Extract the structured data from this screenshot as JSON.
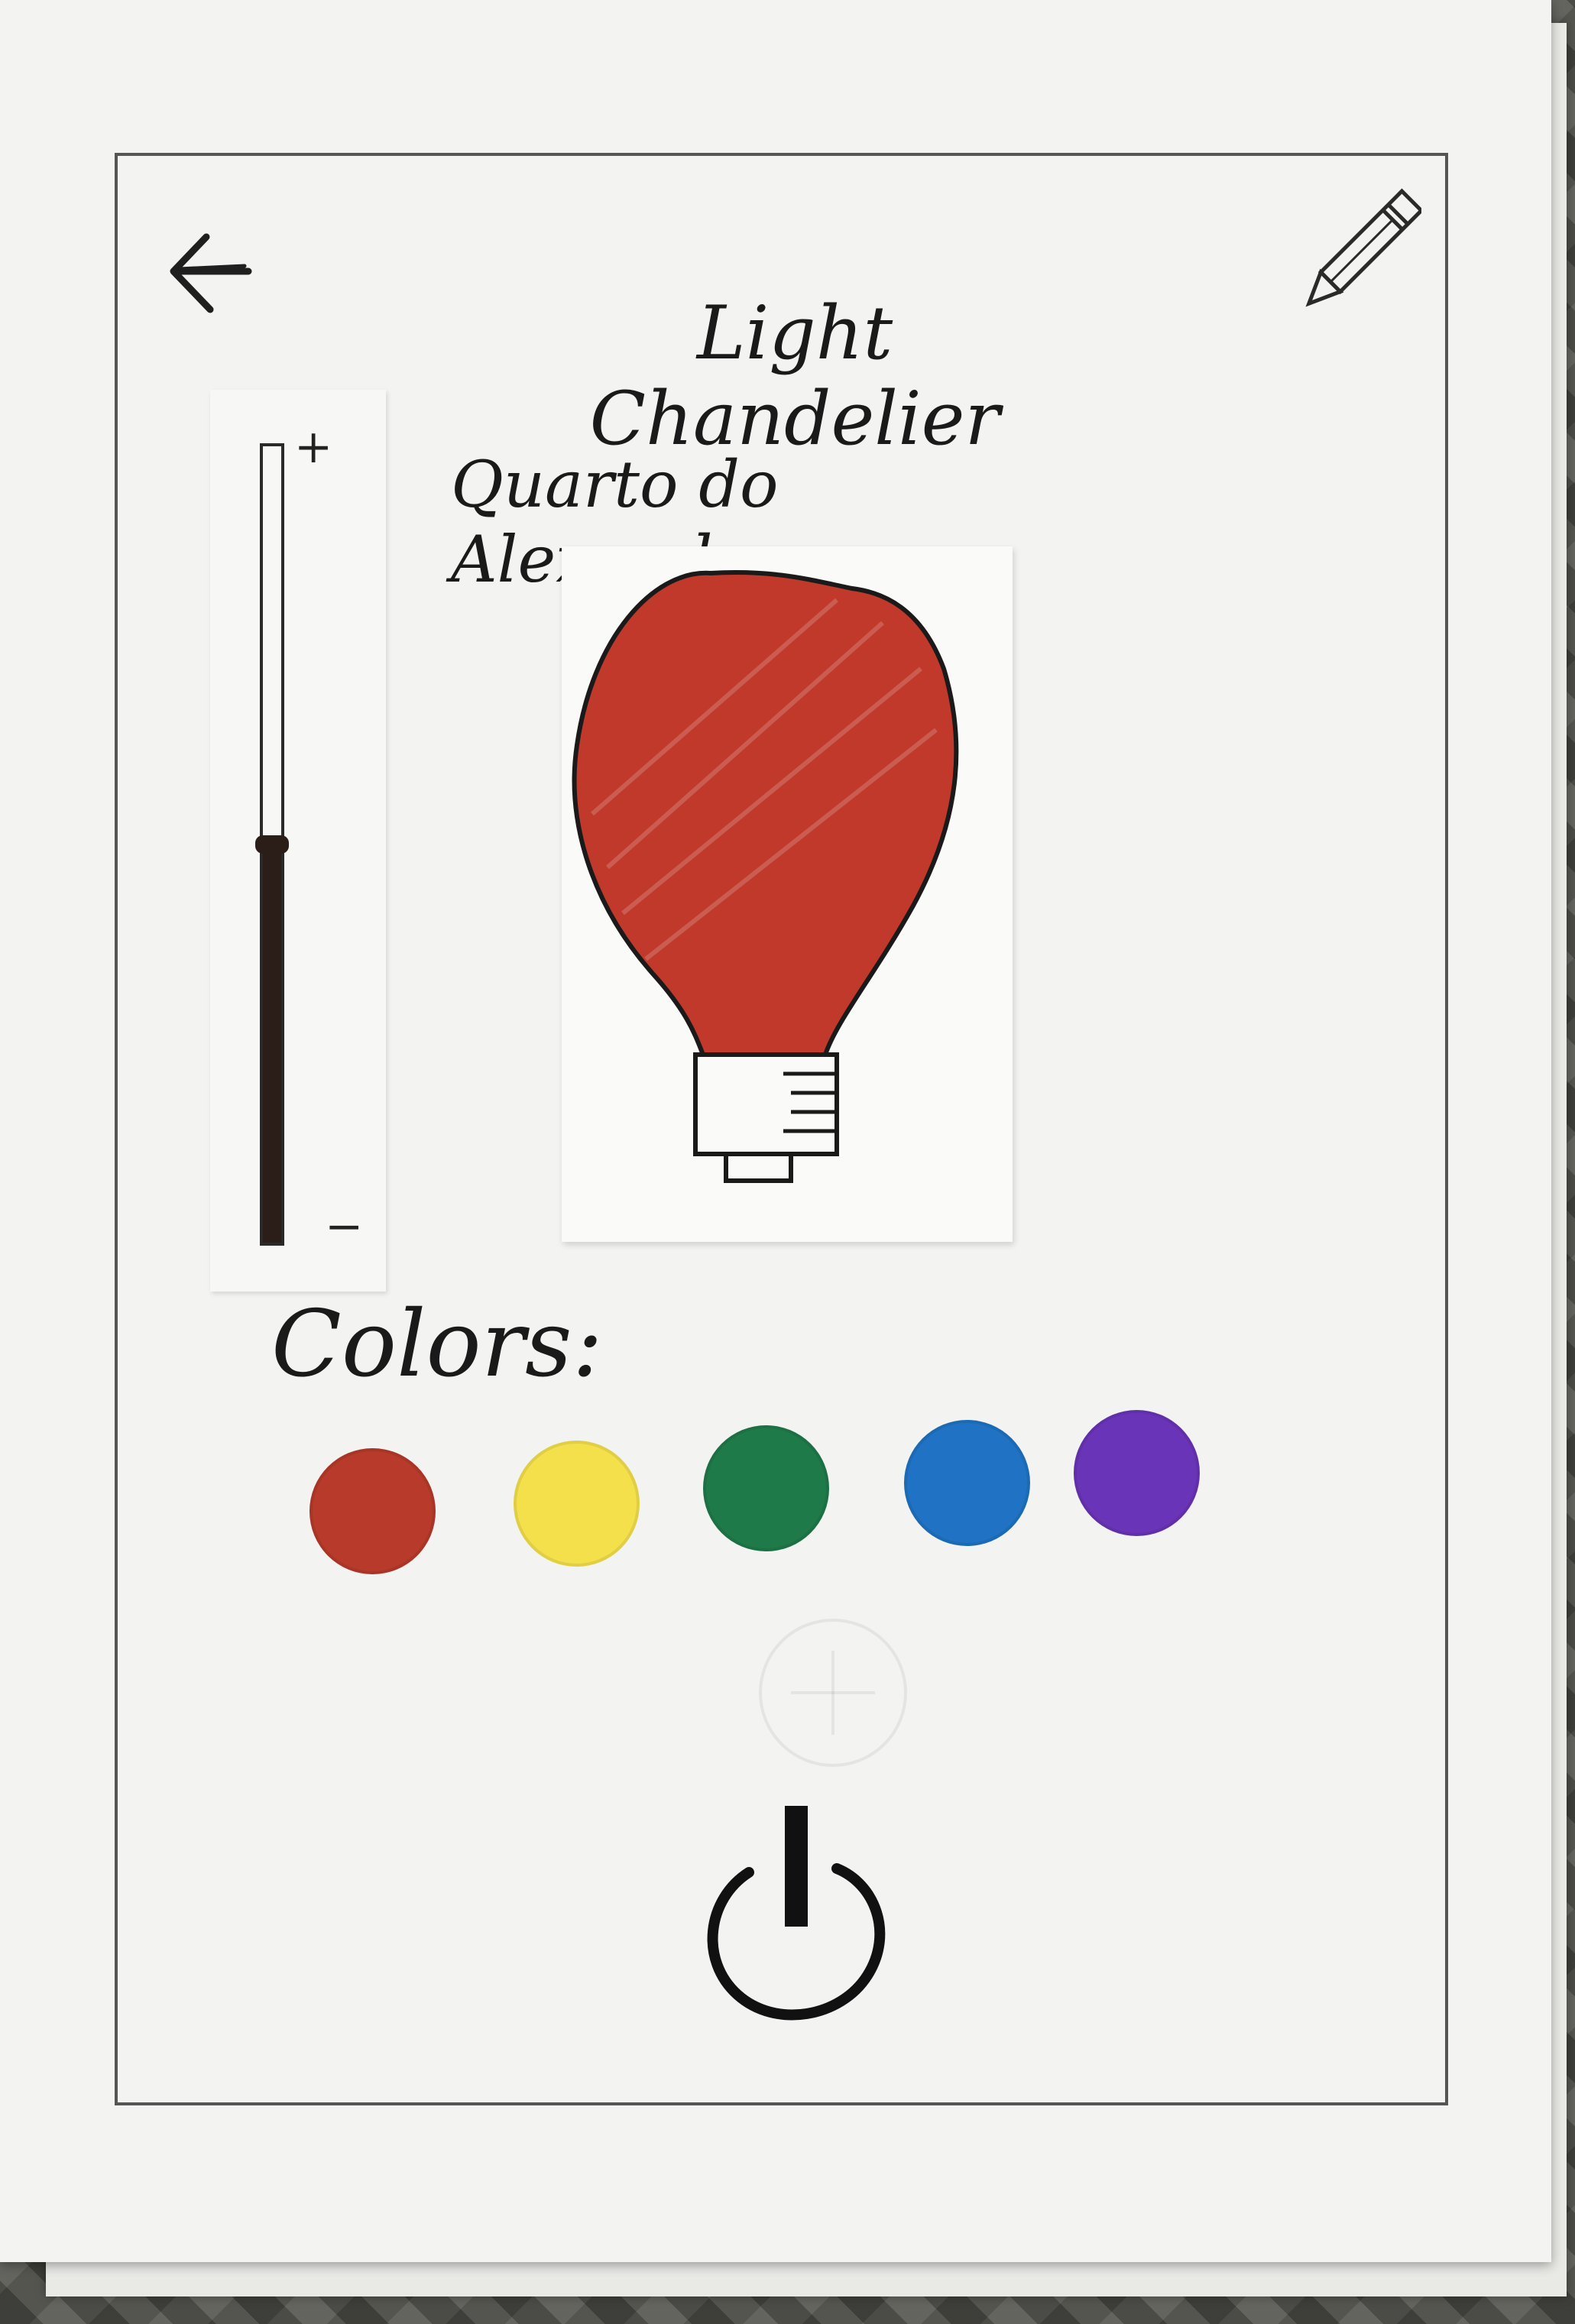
{
  "header": {
    "back_icon": "back-arrow-icon",
    "edit_icon": "pencil-icon",
    "title": "Light Chandelier",
    "room": "Quarto do Alexandre"
  },
  "brightness": {
    "plus_label": "+",
    "minus_label": "−",
    "level": 0.5
  },
  "bulb": {
    "icon": "lightbulb-icon",
    "selected_color": "#c0392b"
  },
  "colors": {
    "label": "Colors:",
    "swatches": [
      {
        "name": "red",
        "hex": "#b83a2a"
      },
      {
        "name": "yellow",
        "hex": "#f4e04a"
      },
      {
        "name": "green",
        "hex": "#1f7a4a"
      },
      {
        "name": "blue",
        "hex": "#1f72c4"
      },
      {
        "name": "purple",
        "hex": "#6a34b8"
      }
    ]
  },
  "power": {
    "icon": "power-icon"
  }
}
